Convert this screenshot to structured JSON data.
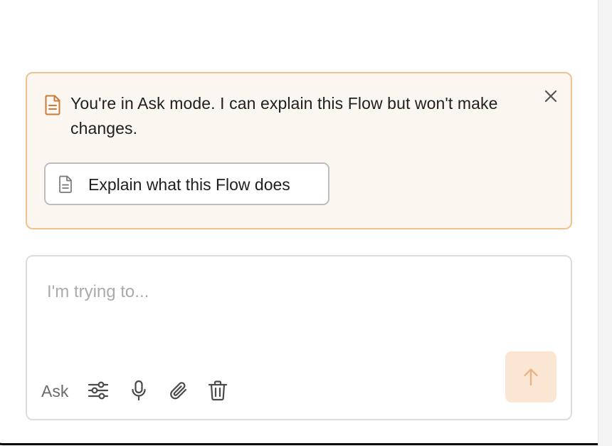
{
  "notice": {
    "message": "You're in Ask mode. I can explain this Flow but won't make changes.",
    "icon": "document-icon",
    "close_icon": "close-icon",
    "accent_color": "#c97c3a",
    "border_color": "#efc28e",
    "background_color": "#fcf6f1",
    "suggestion": {
      "label": "Explain what this Flow does",
      "icon": "document-icon"
    }
  },
  "composer": {
    "placeholder": "I'm trying to...",
    "value": "",
    "mode_label": "Ask",
    "tools": [
      {
        "name": "settings-sliders-icon"
      },
      {
        "name": "microphone-icon"
      },
      {
        "name": "paperclip-icon"
      },
      {
        "name": "trash-icon"
      }
    ],
    "send": {
      "icon": "arrow-up-icon",
      "background_color": "#fbe6d4"
    }
  }
}
